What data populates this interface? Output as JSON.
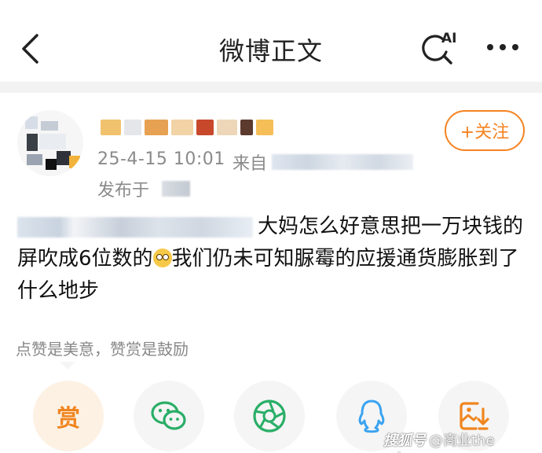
{
  "header": {
    "title": "微博正文",
    "back_icon": "chevron-left-icon",
    "ai_search_icon": "ai-search-icon",
    "more_icon": "more-dots-icon"
  },
  "post": {
    "author_name": "",
    "timestamp": "25-4-15 10:01",
    "source_prefix": "来自",
    "publish_prefix": "发布于",
    "follow_label": "+关注",
    "body_text_1": "大妈怎么好意思把一万块钱的屏吹成6位数的",
    "body_text_2": "我们仍未可知脲霉的应援通货膨胀到了什么地步",
    "emoji": "flushed-face-emoji"
  },
  "reward_hint": "点赞是美意，赞赏是鼓励",
  "share": {
    "reward_label": "赏",
    "items": [
      "reward-icon",
      "wechat-icon",
      "moments-icon",
      "qq-icon",
      "save-image-icon"
    ]
  },
  "watermark": {
    "logo": "搜狐号",
    "text": "@商业the mirror"
  },
  "colors": {
    "accent": "#f58220",
    "wechat": "#2aae67",
    "qq": "#3aa3f0",
    "text_secondary": "#8a8a8a"
  }
}
